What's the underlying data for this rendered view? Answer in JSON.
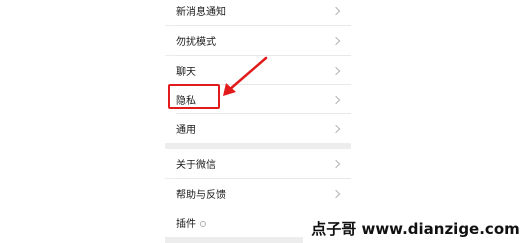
{
  "settings_menu": {
    "items": [
      {
        "label": "新消息通知"
      },
      {
        "label": "勿扰模式"
      },
      {
        "label": "聊天"
      },
      {
        "label": "隐私"
      },
      {
        "label": "通用"
      },
      {
        "label": "关于微信"
      },
      {
        "label": "帮助与反馈"
      },
      {
        "label": "插件"
      }
    ]
  },
  "annotation": {
    "color": "#e11b1b",
    "highlighted_item": "隐私"
  },
  "watermark": {
    "text": "点子哥 www.dianzige.com"
  }
}
